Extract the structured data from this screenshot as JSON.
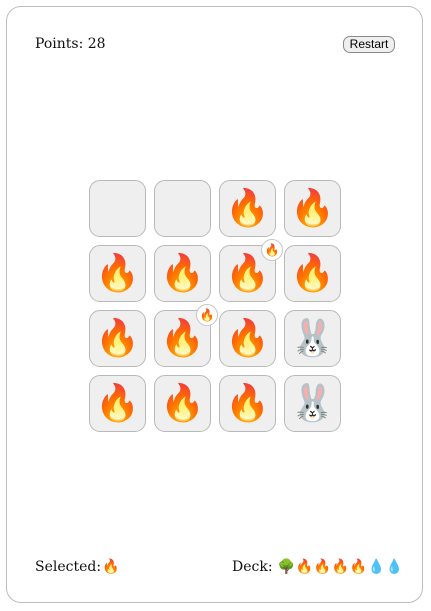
{
  "header": {
    "points_label": "Points:",
    "points_value": "28",
    "restart_label": "Restart"
  },
  "board": {
    "tiles": [
      {
        "name": "tile-r1c1",
        "icon": "",
        "icon_name": "empty"
      },
      {
        "name": "tile-r1c2",
        "icon": "",
        "icon_name": "empty"
      },
      {
        "name": "tile-r1c3",
        "icon": "🔥",
        "icon_name": "fire-icon"
      },
      {
        "name": "tile-r1c4",
        "icon": "🔥",
        "icon_name": "fire-icon"
      },
      {
        "name": "tile-r2c1",
        "icon": "🔥",
        "icon_name": "fire-icon"
      },
      {
        "name": "tile-r2c2",
        "icon": "🔥",
        "icon_name": "fire-icon"
      },
      {
        "name": "tile-r2c3",
        "icon": "🔥",
        "icon_name": "fire-icon"
      },
      {
        "name": "tile-r2c4",
        "icon": "🔥",
        "icon_name": "fire-icon"
      },
      {
        "name": "tile-r3c1",
        "icon": "🔥",
        "icon_name": "fire-icon"
      },
      {
        "name": "tile-r3c2",
        "icon": "🔥",
        "icon_name": "fire-icon"
      },
      {
        "name": "tile-r3c3",
        "icon": "🔥",
        "icon_name": "fire-icon"
      },
      {
        "name": "tile-r3c4",
        "icon": "🐰",
        "icon_name": "rabbit-icon"
      },
      {
        "name": "tile-r4c1",
        "icon": "🔥",
        "icon_name": "fire-icon"
      },
      {
        "name": "tile-r4c2",
        "icon": "🔥",
        "icon_name": "fire-icon"
      },
      {
        "name": "tile-r4c3",
        "icon": "🔥",
        "icon_name": "fire-icon"
      },
      {
        "name": "tile-r4c4",
        "icon": "🐰",
        "icon_name": "rabbit-icon"
      }
    ],
    "badges": [
      {
        "tile": "tile-r2c3",
        "icon": "🔥",
        "icon_name": "fire-badge-icon"
      },
      {
        "tile": "tile-r3c2",
        "icon": "🔥",
        "icon_name": "fire-badge-icon"
      }
    ]
  },
  "footer": {
    "selected_label": "Selected:",
    "selected_icon": "🔥",
    "selected_icon_name": "fire-icon",
    "deck_label": "Deck:",
    "deck_cards": [
      {
        "icon": "🌳",
        "icon_name": "tree-icon"
      },
      {
        "icon": "🔥",
        "icon_name": "fire-icon"
      },
      {
        "icon": "🔥",
        "icon_name": "fire-icon"
      },
      {
        "icon": "🔥",
        "icon_name": "fire-icon"
      },
      {
        "icon": "🔥",
        "icon_name": "fire-icon"
      },
      {
        "icon": "💧",
        "icon_name": "water-drop-icon"
      },
      {
        "icon": "💧",
        "icon_name": "water-drop-icon"
      }
    ]
  }
}
